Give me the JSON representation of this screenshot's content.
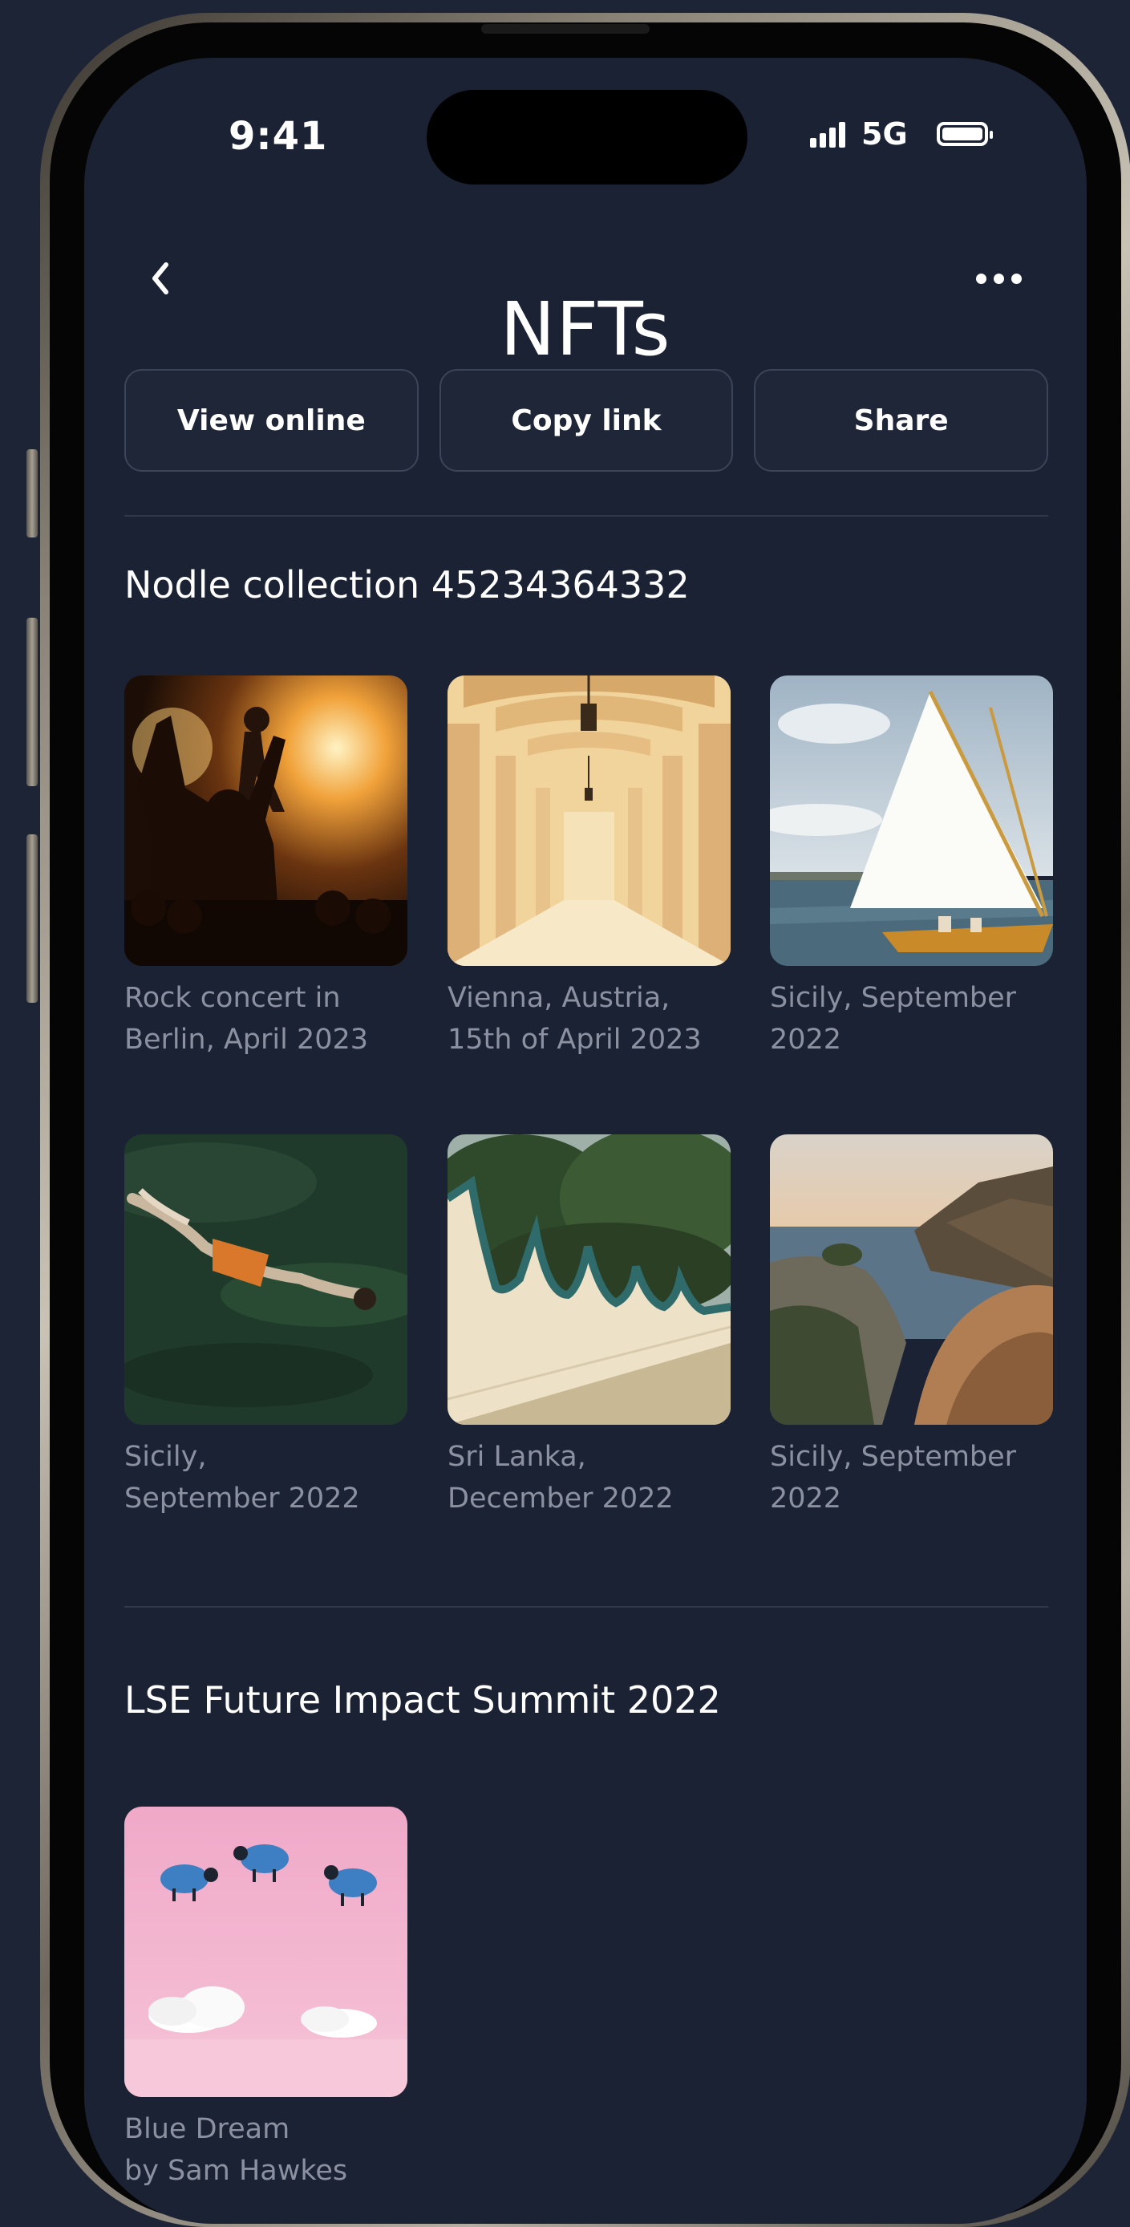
{
  "status_bar": {
    "time": "9:41",
    "network": "5G"
  },
  "header": {
    "title": "NFTs"
  },
  "actions": [
    {
      "label": "View online"
    },
    {
      "label": "Copy link"
    },
    {
      "label": "Share"
    }
  ],
  "sections": [
    {
      "title": "Nodle collection 45234364332",
      "items": [
        {
          "caption": "Rock concert in\nBerlin, April 2023",
          "image": "rock-concert"
        },
        {
          "caption": "Vienna, Austria,\n15th of April 2023",
          "image": "vienna-arcade"
        },
        {
          "caption": "Sicily, September\n2022",
          "image": "sailboat"
        },
        {
          "caption": "Sicily,\nSeptember 2022",
          "image": "swimmer"
        },
        {
          "caption": "Sri Lanka,\nDecember 2022",
          "image": "sri-lanka-wall"
        },
        {
          "caption": "Sicily, September\n2022",
          "image": "coastline"
        }
      ]
    },
    {
      "title": "LSE Future Impact Summit 2022",
      "items": [
        {
          "caption": "Blue Dream\nby Sam Hawkes",
          "image": "blue-sheep"
        }
      ]
    }
  ]
}
